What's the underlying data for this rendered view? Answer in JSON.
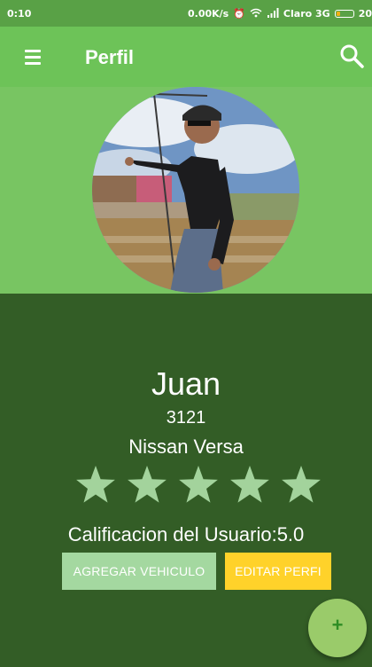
{
  "status_bar": {
    "time": "0:10",
    "network_speed": "0.00K/s",
    "carrier": "Claro 3G",
    "battery_percent": "20",
    "battery_level": 0.2,
    "icons": [
      "alarm-icon",
      "wifi-icon",
      "signal-icon",
      "battery-icon"
    ]
  },
  "app_bar": {
    "title": "Perfil",
    "menu_icon": "menu-icon",
    "search_icon": "search-icon"
  },
  "profile": {
    "avatar_description": "profile-photo",
    "name": "Juan",
    "id": "3121",
    "vehicle": "Nissan Versa",
    "rating_stars": 5,
    "rating_max": 5,
    "rating_text": "Calificacion del Usuario:5.0"
  },
  "actions": {
    "add_vehicle_label": "AGREGAR VEHICULO",
    "edit_profile_label": "EDITAR PERFI",
    "fab_label": "+"
  },
  "colors": {
    "status_bar": "#59a146",
    "app_bar": "#6dc358",
    "hero_background": "#78c562",
    "profile_panel": "#335d26",
    "star": "#a3d39c",
    "add_button": "#a4d8a0",
    "edit_button": "#ffd22a",
    "fab": "#9acb6a"
  }
}
